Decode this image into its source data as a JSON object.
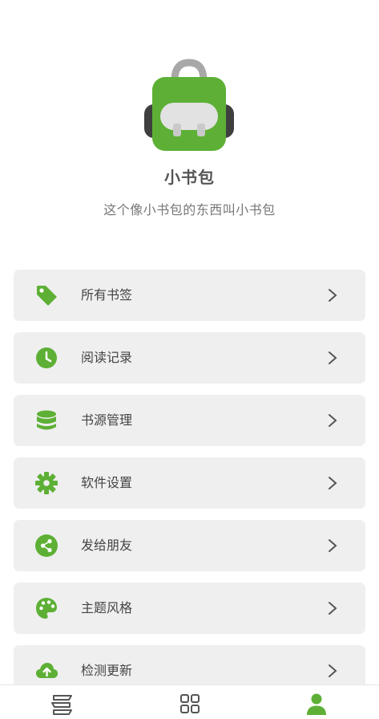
{
  "app": {
    "name": "小书包",
    "slogan": "这个像小书包的东西叫小书包"
  },
  "menu": [
    {
      "label": "所有书签",
      "icon": "tag-icon"
    },
    {
      "label": "阅读记录",
      "icon": "clock-icon"
    },
    {
      "label": "书源管理",
      "icon": "database-icon"
    },
    {
      "label": "软件设置",
      "icon": "gear-icon"
    },
    {
      "label": "发给朋友",
      "icon": "share-icon"
    },
    {
      "label": "主题风格",
      "icon": "palette-icon"
    },
    {
      "label": "检测更新",
      "icon": "cloud-upload-icon"
    }
  ],
  "bottom_nav": [
    {
      "name": "bookshelf",
      "icon": "bookshelf-icon"
    },
    {
      "name": "discover",
      "icon": "grid-icon"
    },
    {
      "name": "mine",
      "icon": "person-icon",
      "active": true
    }
  ],
  "colors": {
    "accent": "#5db035",
    "card": "#efefef",
    "text": "#444444",
    "subtext": "#777777",
    "nav_inactive": "#555555"
  }
}
